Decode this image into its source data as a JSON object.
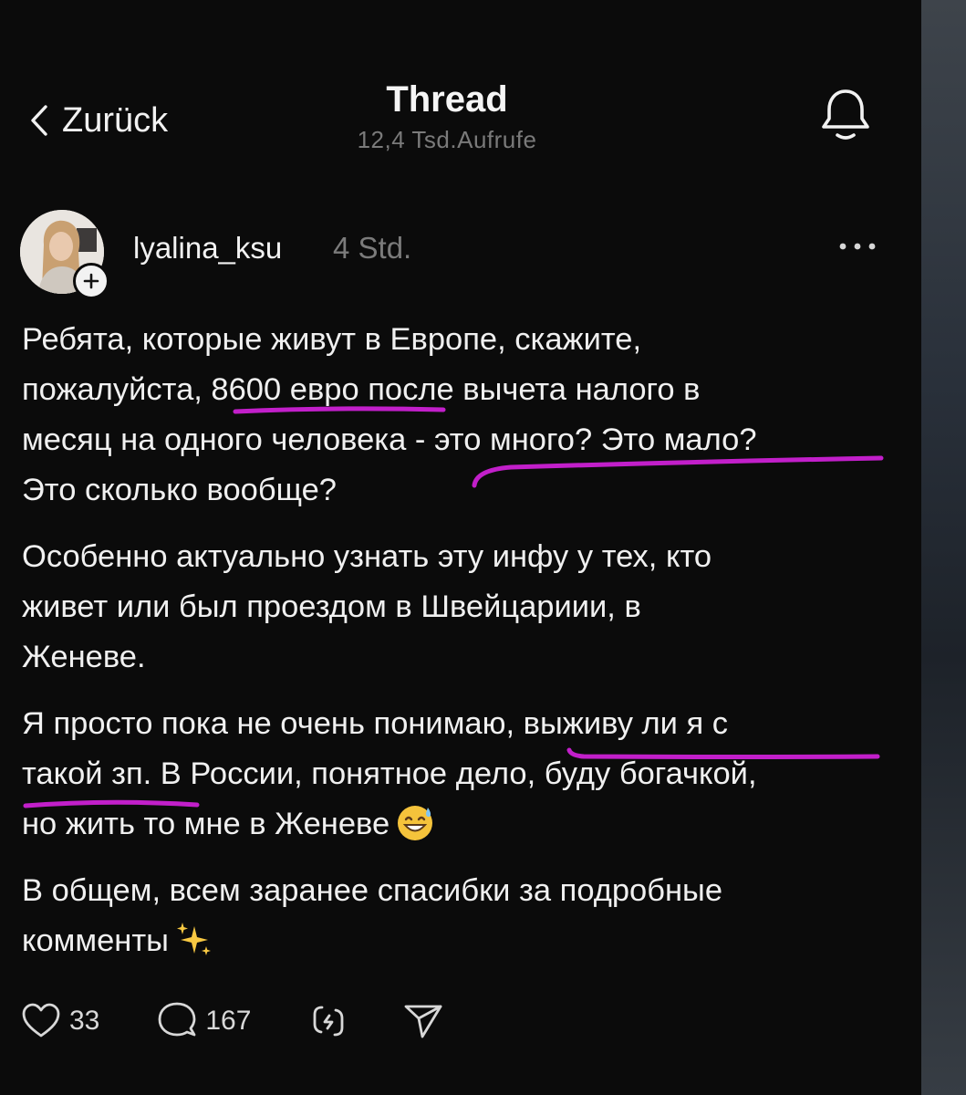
{
  "header": {
    "back_label": "Zurück",
    "title": "Thread",
    "views": "12,4 Tsd.Aufrufe"
  },
  "author": {
    "username": "lyalina_ksu",
    "time": "4 Std."
  },
  "post": {
    "lines": [
      [
        "Ребята, которые живут в Европе, скажите,",
        "пожалуйста, 8600 евро после вычета налого в",
        "месяц на одного человека - это много? Это мало?",
        "Это сколько вообще?"
      ],
      [
        "Особенно актуально узнать эту инфу у тех, кто",
        "живет или был проездом в Швейцариии, в",
        "Женеве."
      ],
      [
        "Я просто пока не очень понимаю, выживу ли я с",
        "такой зп. В России, понятное дело, буду богачкой,",
        "но жить то мне в Женеве"
      ],
      [
        "В общем, всем заранее спасибки за подробные",
        "комменты"
      ]
    ]
  },
  "actions": {
    "likes": "33",
    "comments": "167"
  },
  "icons": [
    "chevron-left-icon",
    "bell-icon",
    "plus-icon",
    "more-icon",
    "heart-icon",
    "comment-icon",
    "repost-icon",
    "send-icon",
    "sweat-smile-emoji",
    "sparkles-emoji"
  ],
  "colors": {
    "background": "#0b0b0b",
    "text": "#f0f0f0",
    "muted": "#7a7a7a",
    "highlight": "#c020c8"
  }
}
